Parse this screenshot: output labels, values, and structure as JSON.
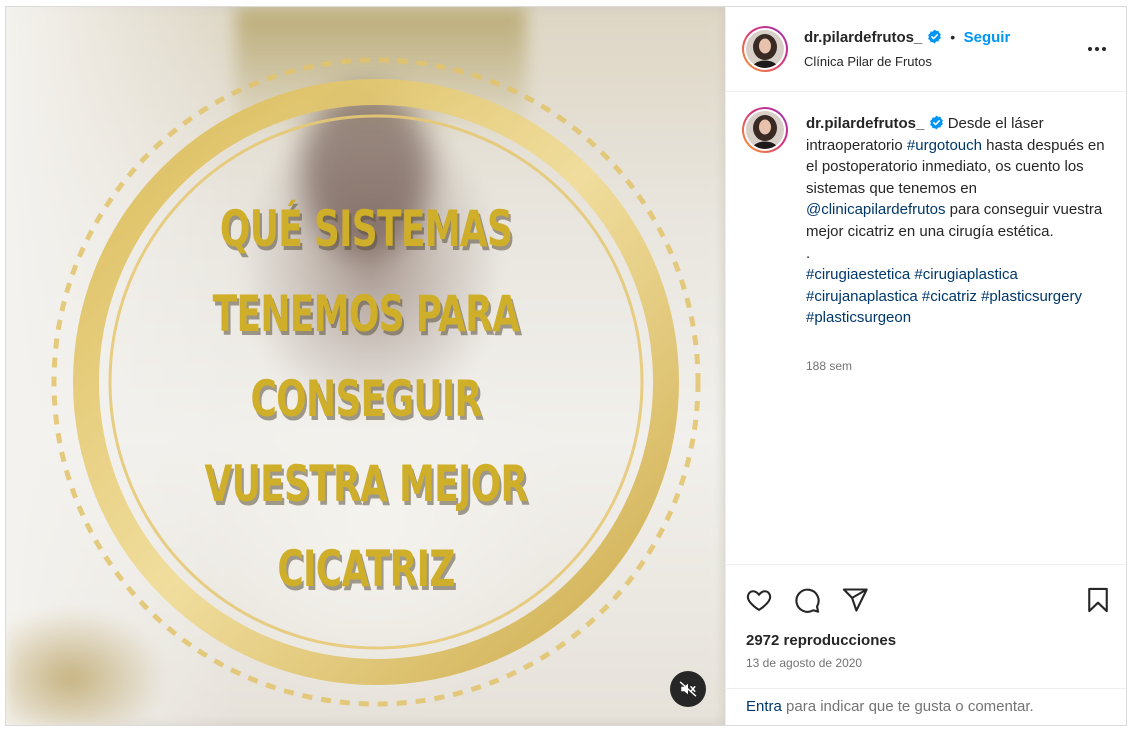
{
  "post": {
    "overlay_text": "QUÉ SISTEMAS\nTENEMOS PARA\nCONSEGUIR\nVUESTRA MEJOR\nCICATRIZ"
  },
  "header": {
    "username": "dr.pilardefrutos_",
    "separator": "•",
    "follow_label": "Seguir",
    "subtitle": "Clínica Pilar de Frutos"
  },
  "caption": {
    "username": "dr.pilardefrutos_",
    "t1": "Desde el láser intraoperatorio ",
    "tag1": "#urgotouch",
    "t2": " hasta después en el postoperatorio inmediato, os cuento los sistemas que tenemos en ",
    "mention": "@clinicapilardefrutos",
    "t3": " para conseguir vuestra mejor cicatriz en una cirugía estética.",
    "dot": ".",
    "hashtags": [
      "#cirugiaestetica",
      "#cirugiaplastica",
      "#cirujanaplastica",
      "#cicatriz",
      "#plasticsurgery",
      "#plasticsurgeon"
    ],
    "time": "188 sem"
  },
  "stats": {
    "views": "2972 reproducciones",
    "date": "13 de agosto de 2020"
  },
  "footer": {
    "login": "Entra",
    "rest": " para indicar que te gusta o comentar."
  },
  "icons": {
    "more": "more-options-icon",
    "verified": "verified-badge-icon",
    "like": "heart-icon",
    "comment": "comment-icon",
    "share": "send-icon",
    "save": "bookmark-icon",
    "mute": "speaker-muted-icon"
  },
  "colors": {
    "link": "#00376b",
    "follow": "#0095f6",
    "verified": "#0095f6",
    "overlay_text": "#cfae2a",
    "muted_text": "#737373"
  }
}
